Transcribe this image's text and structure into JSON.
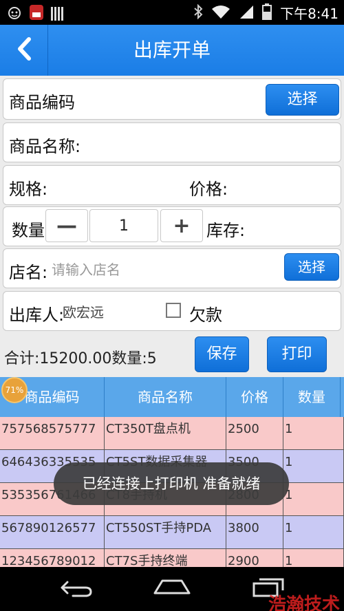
{
  "status_bar": {
    "icons": [
      "smiley-cat-icon",
      "app-badge-icon",
      "barcode-icon"
    ],
    "right_icons": [
      "bluetooth-icon",
      "wifi-icon",
      "signal-icon",
      "battery-icon"
    ],
    "time": "下午8:41"
  },
  "header": {
    "back_icon": "chevron-left-icon",
    "title": "出库开单"
  },
  "form": {
    "product_code_label": "商品编码",
    "select_label": "选择",
    "product_name_label": "商品名称:",
    "spec_label": "规格:",
    "price_label": "价格:",
    "quantity_label": "数量",
    "minus_label": "—",
    "quantity_value": "1",
    "plus_label": "+",
    "stock_label": "库存:",
    "store_label": "店名:",
    "store_placeholder": "请输入店名",
    "store_select_label": "选择",
    "operator_label": "出库人:",
    "operator_value": "欧宏远",
    "debt_label": "欠款"
  },
  "summary": {
    "text": "合计:15200.00数量:5"
  },
  "actions": {
    "save_label": "保存",
    "print_label": "打印"
  },
  "table": {
    "headers": [
      "商品编码",
      "商品名称",
      "价格",
      "数量"
    ],
    "rows": [
      {
        "code": "757568575777",
        "name": "CT350T盘点机",
        "price": "2500",
        "qty": "1",
        "color": "#f9c9c9"
      },
      {
        "code": "646436335535",
        "name": "CT5ST数据采集器",
        "price": "3500",
        "qty": "1",
        "color": "#c9c9f4"
      },
      {
        "code": "535356761466",
        "name": "CT8手持机",
        "price": "2800",
        "qty": "1",
        "color": "#f9c9c9"
      },
      {
        "code": "567890126577",
        "name": "CT550ST手持PDA",
        "price": "3800",
        "qty": "1",
        "color": "#c9c9f4"
      },
      {
        "code": "123456789012",
        "name": "CT7S手持终端",
        "price": "2900",
        "qty": "1",
        "color": "#f9c9c9"
      }
    ]
  },
  "toast": {
    "text": "已经连接上打印机 准备就绪"
  },
  "overlay_badge": {
    "text": "71%"
  },
  "navbar": {
    "icons": [
      "back-nav-icon",
      "home-nav-icon",
      "recents-nav-icon"
    ]
  },
  "watermark": {
    "text": "浩瀚技术"
  }
}
